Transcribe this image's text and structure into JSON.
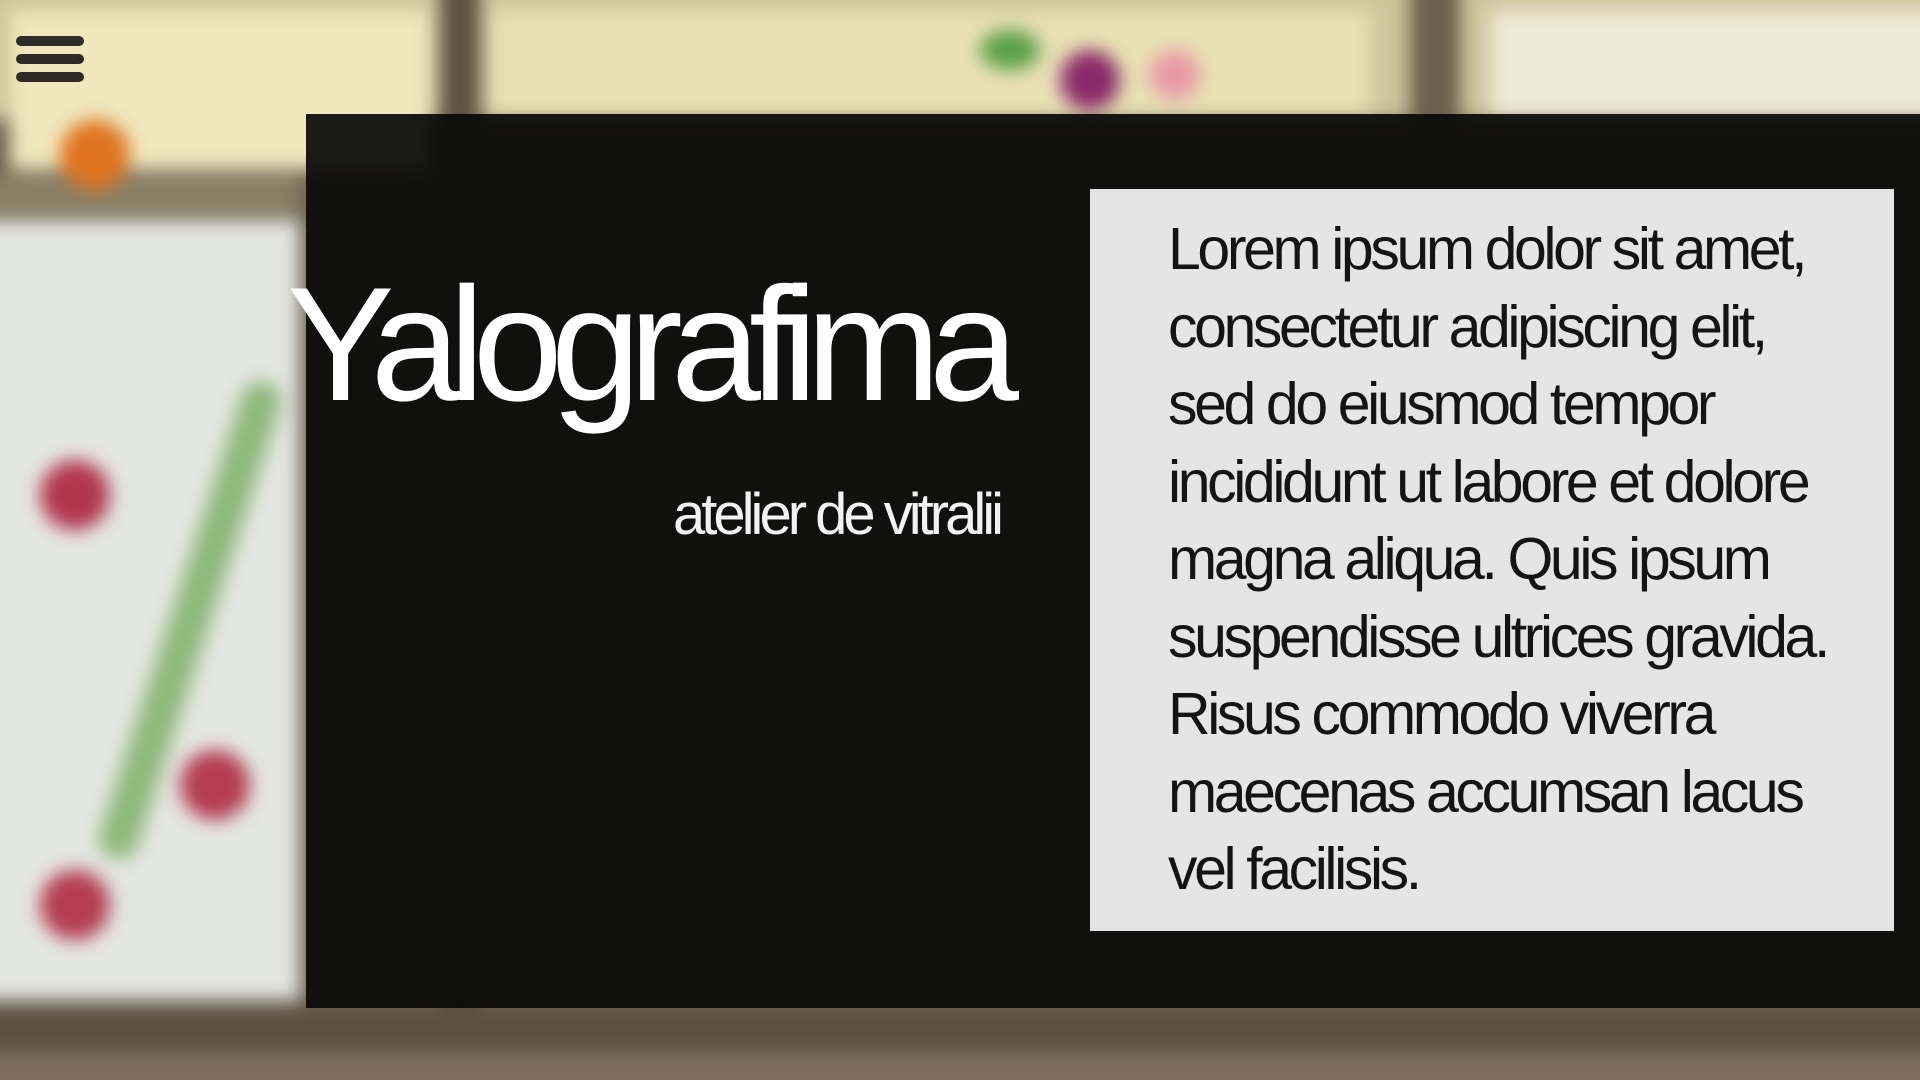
{
  "brand": {
    "title": "Yalografima",
    "subtitle": "atelier de vitralii"
  },
  "navigation": {
    "menu_icon": "hamburger-menu-icon"
  },
  "content": {
    "paragraph": "Lorem ipsum dolor sit amet, consectetur adipiscing elit, sed do eiusmod tempor incididunt ut labore et dolore magna aliqua. Quis ipsum suspendisse ultrices gravida. Risus commodo viverra maecenas accumsan lacus vel facilisis."
  },
  "colors": {
    "hero_panel": "#0a0a0a",
    "text_card": "#ececec",
    "brand_text": "#ffffff",
    "body_text": "#141414",
    "menu_icon": "#2f2c28"
  }
}
